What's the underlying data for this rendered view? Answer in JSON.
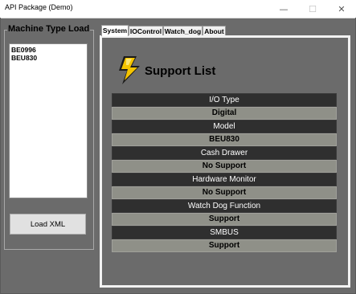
{
  "window": {
    "title": "API Package (Demo)",
    "controls": {
      "minimize": "—",
      "maximize": "☐",
      "close": "✕"
    }
  },
  "left_panel": {
    "group_title": "Machine Type Load",
    "list_items": [
      "BE0996",
      "BEU830"
    ],
    "load_button": "Load XML"
  },
  "tabs": [
    {
      "label": "System",
      "active": true
    },
    {
      "label": "IOControl",
      "active": false
    },
    {
      "label": "Watch_dog",
      "active": false
    },
    {
      "label": "About",
      "active": false
    }
  ],
  "main": {
    "title": "Support List",
    "logo_icon": "lightning-bolt-icon",
    "rows": [
      {
        "header": "I/O Type",
        "value": "Digital"
      },
      {
        "header": "Model",
        "value": "BEU830"
      },
      {
        "header": "Cash Drawer",
        "value": "No Support"
      },
      {
        "header": "Hardware Monitor",
        "value": "No Support"
      },
      {
        "header": "Watch Dog Function",
        "value": "Support"
      },
      {
        "header": "SMBUS",
        "value": "Support"
      }
    ]
  },
  "colors": {
    "background": "#6b6b6b",
    "row_header": "#2f2f2f",
    "row_value": "#8f9088",
    "logo_yellow": "#f5c400"
  }
}
